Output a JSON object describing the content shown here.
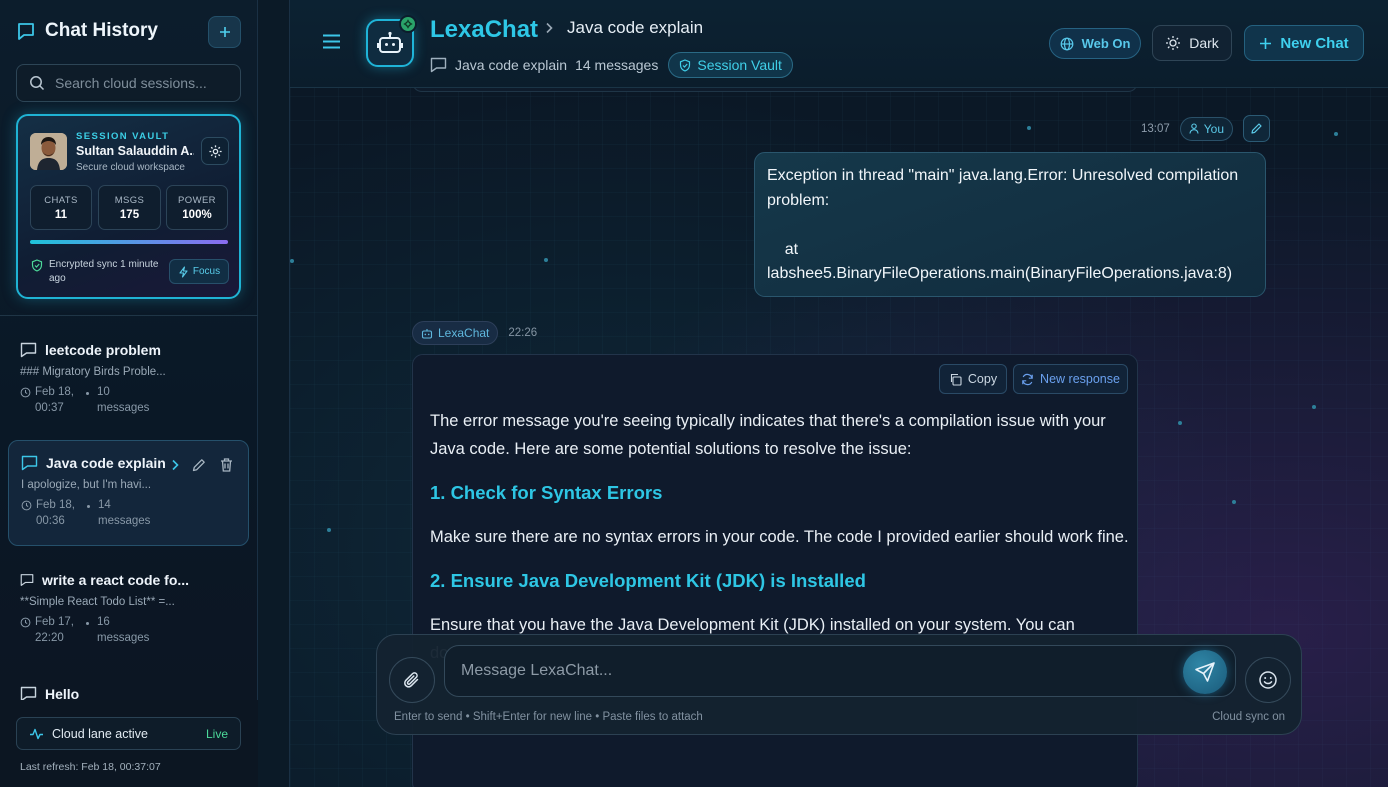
{
  "sidebar": {
    "title": "Chat History",
    "search_placeholder": "Search cloud sessions...",
    "vault": {
      "label": "SESSION VAULT",
      "user_name": "Sultan Salauddin A...",
      "subtitle": "Secure cloud workspace",
      "stats": [
        {
          "label": "CHATS",
          "value": "11"
        },
        {
          "label": "MSGS",
          "value": "175"
        },
        {
          "label": "POWER",
          "value": "100%"
        }
      ],
      "power_fraction": 1.0,
      "sync_text": "Encrypted sync 1 minute ago",
      "focus_label": "Focus"
    },
    "chats": [
      {
        "title": "leetcode problem",
        "preview": "### Migratory Birds Proble...",
        "date": "Feb 18, 00:37",
        "count": "10 messages"
      },
      {
        "title": "Java code explain",
        "preview": "I apologize, but I'm havi...",
        "date": "Feb 18, 00:36",
        "count": "14 messages"
      },
      {
        "title": "write a react code fo...",
        "preview": "**Simple React Todo List** =...",
        "date": "Feb 17, 22:20",
        "count": "16 messages"
      },
      {
        "title": "Hello"
      }
    ],
    "status_label": "Cloud lane active",
    "status_live": "Live",
    "last_refresh": "Last refresh: Feb 18, 00:37:07"
  },
  "header": {
    "brand": "LexaChat",
    "crumb": "Java code explain",
    "sub_title": "Java code explain",
    "sub_count": "14 messages",
    "vault_badge": "Session Vault",
    "web_label": "Web On",
    "theme_label": "Dark",
    "new_chat_label": "New Chat"
  },
  "conversation": {
    "user_time": "13:07",
    "user_label": "You",
    "user_message": "Exception in thread \"main\" java.lang.Error: Unresolved compilation problem:\n\n    at labshee5.BinaryFileOperations.main(BinaryFileOperations.java:8)",
    "bot_label": "LexaChat",
    "bot_time": "22:26",
    "copy_label": "Copy",
    "new_response_label": "New response",
    "bot_intro": "The error message you're seeing typically indicates that there's a compilation issue with your Java code. Here are some potential solutions to resolve the issue:",
    "bot_h1": "1. Check for Syntax Errors",
    "bot_p1": "Make sure there are no syntax errors in your code. The code I provided earlier should work fine.",
    "bot_h2": "2. Ensure Java Development Kit (JDK) is Installed",
    "bot_p2": "Ensure that you have the Java Development Kit (JDK) installed on your system. You can download"
  },
  "composer": {
    "placeholder": "Message LexaChat...",
    "hint": "Enter to send • Shift+Enter for new line • Paste files to attach",
    "sync_status": "Cloud sync on"
  },
  "colors": {
    "accent": "#2ec7e6",
    "live": "#4cd99a",
    "purple": "#8a6cf0"
  }
}
